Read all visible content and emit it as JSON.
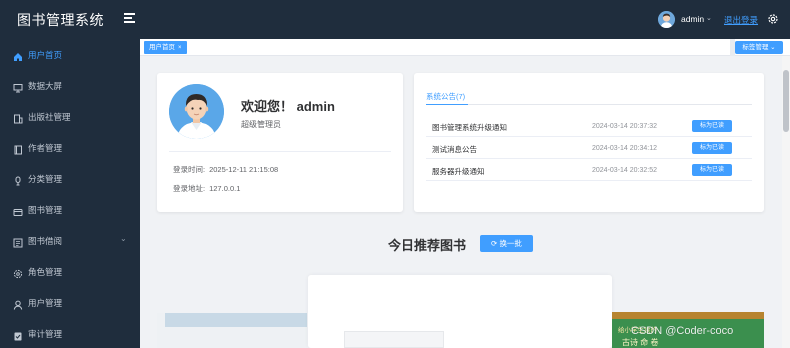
{
  "header": {
    "app_title": "图书管理系统",
    "user_name": "admin",
    "logout_label": "退出登录"
  },
  "sidebar": {
    "items": [
      {
        "label": "用户首页",
        "icon": "home-icon",
        "active": true
      },
      {
        "label": "数据大屏",
        "icon": "monitor-icon"
      },
      {
        "label": "出版社管理",
        "icon": "building-icon"
      },
      {
        "label": "作者管理",
        "icon": "book-icon"
      },
      {
        "label": "分类管理",
        "icon": "category-icon"
      },
      {
        "label": "图书管理",
        "icon": "folder-icon"
      },
      {
        "label": "图书借阅",
        "icon": "borrow-icon",
        "has_submenu": true
      },
      {
        "label": "角色管理",
        "icon": "settings-icon"
      },
      {
        "label": "用户管理",
        "icon": "user-icon"
      },
      {
        "label": "审计管理",
        "icon": "clipboard-icon"
      }
    ]
  },
  "tabs": {
    "home_tab": "用户首页",
    "tag_manage_label": "标签管理"
  },
  "welcome": {
    "greeting": "欢迎您！ admin",
    "role": "超级管理员",
    "login_time_label": "登录时间:",
    "login_time_value": "2025-12-11 21:15:08",
    "login_addr_label": "登录地址:",
    "login_addr_value": "127.0.0.1"
  },
  "notices": {
    "tab_label": "系统公告(7)",
    "mark_read_label": "标为已读",
    "items": [
      {
        "title": "图书管理系统升级通知",
        "date": "2024-03-14 20:37:32"
      },
      {
        "title": "测试消息公告",
        "date": "2024-03-14 20:34:12"
      },
      {
        "title": "服务器升级通知",
        "date": "2024-03-14 20:32:52"
      }
    ]
  },
  "recommend": {
    "title": "今日推荐图书",
    "refresh_label": "换一批"
  },
  "books": {
    "right_cover_line1": "给小学生读的",
    "right_cover_line2": "古诗 命 卷"
  },
  "watermark": "CSDN @Coder-coco",
  "colors": {
    "sidebar_bg": "#1f2d3d",
    "accent": "#409eff",
    "page_bg": "#f0f2f5"
  }
}
